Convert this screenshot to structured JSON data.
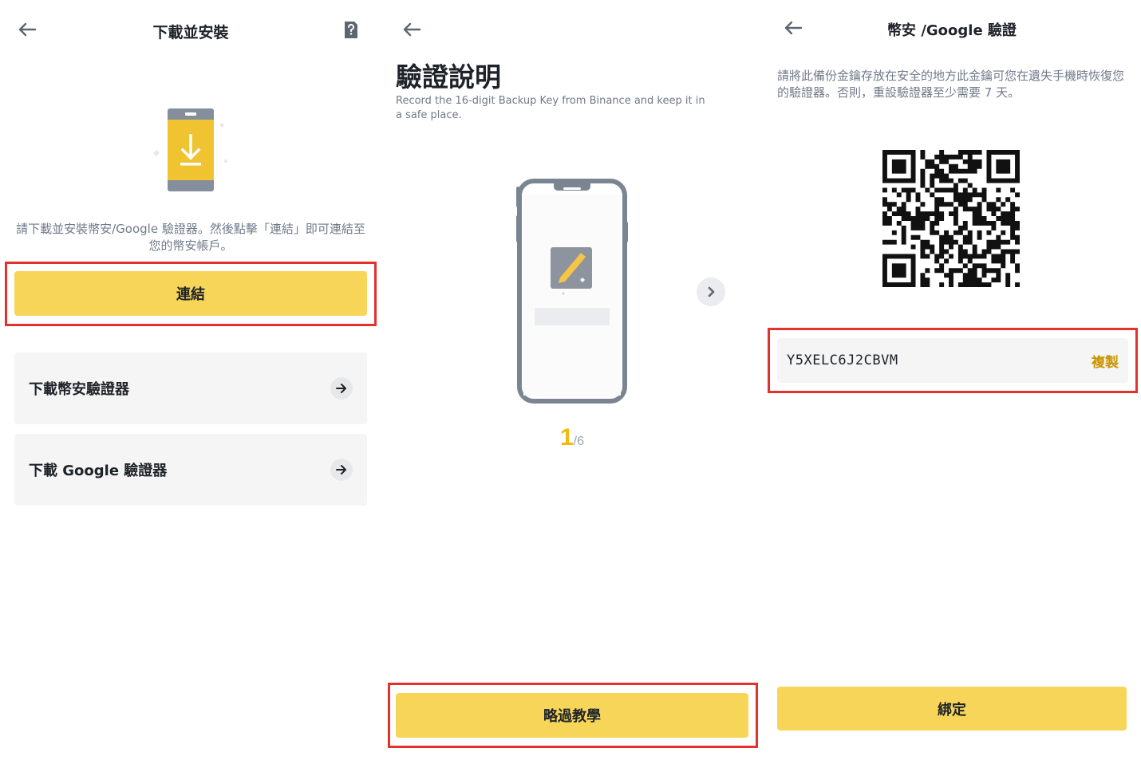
{
  "panel1": {
    "title": "下載並安裝",
    "description": "請下載並安裝幣安/Google 驗證器。然後點擊「連結」即可連結至您的幣安帳戶。",
    "connect_button": "連結",
    "links": [
      {
        "label": "下載幣安驗證器"
      },
      {
        "label": "下載 Google 驗證器"
      }
    ],
    "icons": {
      "back": "arrow-left",
      "help": "help-document",
      "hero": "phone-download",
      "link_arrow": "arrow-right"
    }
  },
  "panel2": {
    "title": "驗證說明",
    "subtitle": "Record the 16-digit Backup Key from Binance and keep it in a safe place.",
    "page_current": "1",
    "page_total": "/6",
    "skip_button": "略過教學",
    "icons": {
      "back": "arrow-left",
      "next": "chevron-right",
      "illustration": "phone-note"
    }
  },
  "panel3": {
    "title": "幣安 /Google 驗證",
    "description": "請將此備份金鑰存放在安全的地方此金鑰可您在遺失手機時恢復您的驗證器。否則，重設驗證器至少需要 7 天。",
    "backup_key": "Y5XELC6J2CBVM",
    "copy_label": "複製",
    "bind_button": "綁定",
    "icons": {
      "back": "arrow-left",
      "qr": "qr-code"
    }
  },
  "colors": {
    "accent_yellow": "#f6d558",
    "brand_gold": "#f0b90b",
    "highlight_red": "#e2322b",
    "text_primary": "#1e2329",
    "text_secondary": "#707a8a"
  }
}
